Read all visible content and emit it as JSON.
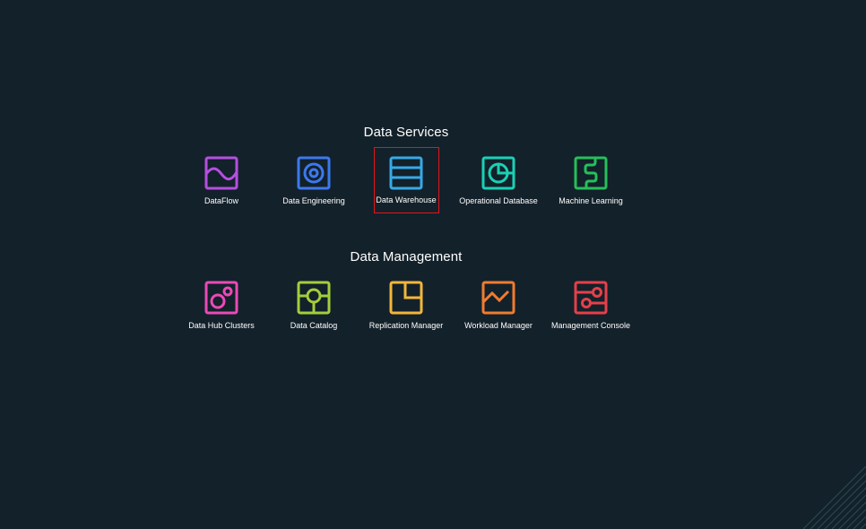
{
  "sections": [
    {
      "title": "Data Services",
      "items": [
        {
          "label": "DataFlow",
          "icon": "dataflow-icon",
          "color": "#b64fe0"
        },
        {
          "label": "Data Engineering",
          "icon": "data-engineering-icon",
          "color": "#3c79ee"
        },
        {
          "label": "Data Warehouse",
          "icon": "data-warehouse-icon",
          "color": "#37a9e6"
        },
        {
          "label": "Operational Database",
          "icon": "operational-database-icon",
          "color": "#19d1b5"
        },
        {
          "label": "Machine Learning",
          "icon": "machine-learning-icon",
          "color": "#26bf5b"
        }
      ]
    },
    {
      "title": "Data Management",
      "items": [
        {
          "label": "Data Hub Clusters",
          "icon": "data-hub-clusters-icon",
          "color": "#ea4ab6"
        },
        {
          "label": "Data Catalog",
          "icon": "data-catalog-icon",
          "color": "#a3ce3c"
        },
        {
          "label": "Replication Manager",
          "icon": "replication-manager-icon",
          "color": "#f3b63b"
        },
        {
          "label": "Workload Manager",
          "icon": "workload-manager-icon",
          "color": "#f07c2f"
        },
        {
          "label": "Management Console",
          "icon": "management-console-icon",
          "color": "#e5404a"
        }
      ]
    }
  ],
  "selected_item": "Data Warehouse",
  "selection_color": "#e0161e",
  "background_color": "#13212a"
}
